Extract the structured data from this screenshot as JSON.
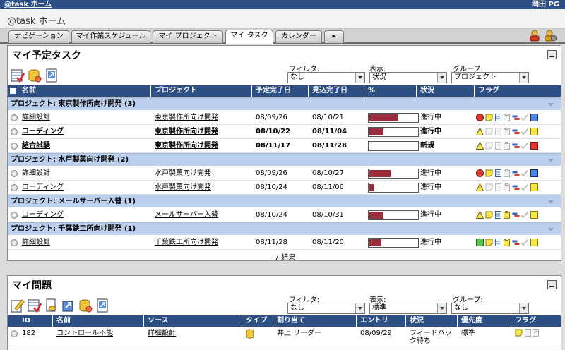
{
  "topbar": {
    "left": "@task ホーム",
    "right": "岡田 PG"
  },
  "title": "@task ホーム",
  "tabs": [
    {
      "label": "ナビゲーション",
      "active": false
    },
    {
      "label": "マイ作業スケジュール",
      "active": false
    },
    {
      "label": "マイ プロジェクト",
      "active": false
    },
    {
      "label": "マイ タスク",
      "active": true
    },
    {
      "label": "カレンダー",
      "active": false
    },
    {
      "label": "▸",
      "active": false
    }
  ],
  "tasks": {
    "title": "マイ予定タスク",
    "filter_label": "フィルタ:",
    "filter_value": "なし",
    "view_label": "表示:",
    "view_value": "状況",
    "group_label": "グループ:",
    "group_value": "プロジェクト",
    "columns": [
      "名前",
      "プロジェクト",
      "予定完了日",
      "見込完了日",
      "%",
      "状況",
      "フラグ"
    ],
    "groups": [
      {
        "title": "プロジェクト: 東京製作所向け開発 (3)",
        "rows": [
          {
            "name": "詳細設計",
            "project": "東京製作所向け開発",
            "planned": "08/09/26",
            "expected": "08/10/21",
            "percent": 0.6,
            "status": "進行中",
            "bold": false,
            "flags": [
              "red-circle",
              "yellow-note",
              "blue-doc",
              "clipboard",
              "tag",
              "check",
              "blue-square"
            ]
          },
          {
            "name": "コーディング",
            "project": "東京製作所向け開発",
            "planned": "08/10/22",
            "expected": "08/11/04",
            "percent": 0.3,
            "status": "進行中",
            "bold": true,
            "flags": [
              "yellow-triangle",
              "gray-note",
              "gray-doc",
              "clipboard",
              "tag",
              "check",
              "yellow-square"
            ]
          },
          {
            "name": "結合試験",
            "project": "東京製作所向け開発",
            "planned": "08/11/17",
            "expected": "08/11/28",
            "percent": 0.0,
            "status": "新規",
            "bold": true,
            "flags": [
              "yellow-triangle",
              "gray-note",
              "gray-doc",
              "clipboard",
              "tag",
              "check",
              "red-square"
            ]
          }
        ]
      },
      {
        "title": "プロジェクト: 水戸製菓向け開発 (2)",
        "rows": [
          {
            "name": "詳細設計",
            "project": "水戸製菓向け開発",
            "planned": "08/09/26",
            "expected": "08/10/27",
            "percent": 0.45,
            "status": "進行中",
            "bold": false,
            "flags": [
              "red-circle",
              "yellow-note",
              "blue-doc",
              "clipboard",
              "tag",
              "check",
              "blue-square"
            ]
          },
          {
            "name": "コーディング",
            "project": "水戸製菓向け開発",
            "planned": "08/10/24",
            "expected": "08/11/06",
            "percent": 0.1,
            "status": "進行中",
            "bold": false,
            "flags": [
              "yellow-triangle",
              "gray-note",
              "gray-doc",
              "clipboard",
              "tag",
              "check",
              "yellow-square"
            ]
          }
        ]
      },
      {
        "title": "プロジェクト: メールサーバー入替 (1)",
        "rows": [
          {
            "name": "コーディング",
            "project": "メールサーバー入替",
            "planned": "08/10/24",
            "expected": "08/10/31",
            "percent": 0.3,
            "status": "進行中",
            "bold": false,
            "flags": [
              "yellow-triangle",
              "yellow-note",
              "blue-doc",
              "yellow-clip",
              "tag",
              "check",
              "yellow-square"
            ]
          }
        ]
      },
      {
        "title": "プロジェクト: 千葉鉄工所向け開発 (1)",
        "rows": [
          {
            "name": "詳細設計",
            "project": "千葉鉄工所向け開発",
            "planned": "08/11/28",
            "expected": "08/11/20",
            "percent": 0.25,
            "status": "進行中",
            "bold": false,
            "flags": [
              "green-square",
              "yellow-note",
              "blue-doc",
              "yellow-clip",
              "tag",
              "check",
              "yellow-square"
            ]
          }
        ]
      }
    ],
    "result_count": "7 結果"
  },
  "issues": {
    "title": "マイ問題",
    "filter_label": "フィルタ:",
    "filter_value": "なし",
    "view_label": "表示:",
    "view_value": "標準",
    "group_label": "グループ:",
    "group_value": "なし",
    "columns": [
      "ID",
      "名前",
      "ソース",
      "タイプ",
      "割り当て",
      "エントリ",
      "状況",
      "優先度",
      "フラグ"
    ],
    "rows": [
      {
        "id": "182",
        "name": "コントロール不能",
        "source": "詳細設計",
        "assigned": "井上 リーダー",
        "entry": "08/09/29",
        "status": "フィードバック待ち",
        "priority": "標準"
      }
    ]
  },
  "colors": {
    "header": "#2c4f86",
    "group": "#bcd0ee",
    "bar": "#9a2d3b"
  }
}
